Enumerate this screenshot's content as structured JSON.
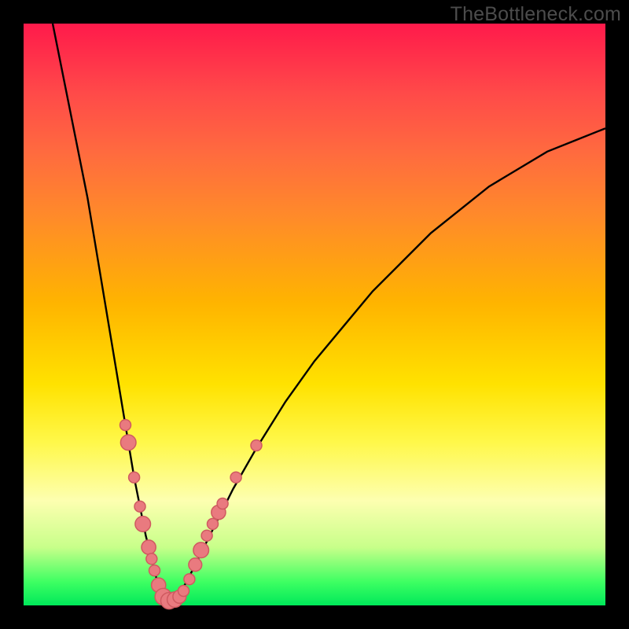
{
  "watermark": "TheBottleneck.com",
  "colors": {
    "frame_bg": "#000000",
    "gradient_stops": [
      {
        "pct": 0,
        "hex": "#ff1a4b"
      },
      {
        "pct": 12,
        "hex": "#ff4a49"
      },
      {
        "pct": 22,
        "hex": "#ff6a3f"
      },
      {
        "pct": 33,
        "hex": "#ff8a2a"
      },
      {
        "pct": 48,
        "hex": "#ffb400"
      },
      {
        "pct": 62,
        "hex": "#ffe200"
      },
      {
        "pct": 72,
        "hex": "#fff84a"
      },
      {
        "pct": 82,
        "hex": "#fdffb0"
      },
      {
        "pct": 90,
        "hex": "#c8ff8a"
      },
      {
        "pct": 96,
        "hex": "#3dff62"
      },
      {
        "pct": 100,
        "hex": "#00e85a"
      }
    ],
    "curve_stroke": "#000000",
    "dot_fill": "#e97a7f",
    "dot_stroke": "#cf5a60"
  },
  "chart_data": {
    "type": "line",
    "title": "",
    "xlabel": "",
    "ylabel": "",
    "xlim": [
      0,
      100
    ],
    "ylim": [
      0,
      100
    ],
    "grid": false,
    "curve": {
      "note": "Black V-shaped absolute-difference style curve; minimum at roughly x≈24, y≈0; left branch rises steeply to y=100 near x≈5; right branch rises gradually to y≈80 at x=100. Values estimated from pixels.",
      "points": [
        {
          "x": 5.0,
          "y": 100.0
        },
        {
          "x": 7.0,
          "y": 90.0
        },
        {
          "x": 9.0,
          "y": 80.0
        },
        {
          "x": 11.0,
          "y": 70.0
        },
        {
          "x": 13.0,
          "y": 58.0
        },
        {
          "x": 15.0,
          "y": 46.0
        },
        {
          "x": 17.0,
          "y": 34.0
        },
        {
          "x": 19.0,
          "y": 22.0
        },
        {
          "x": 21.0,
          "y": 12.0
        },
        {
          "x": 23.0,
          "y": 4.0
        },
        {
          "x": 24.0,
          "y": 1.0
        },
        {
          "x": 25.0,
          "y": 0.5
        },
        {
          "x": 26.0,
          "y": 1.0
        },
        {
          "x": 28.0,
          "y": 4.0
        },
        {
          "x": 30.0,
          "y": 8.0
        },
        {
          "x": 33.0,
          "y": 14.0
        },
        {
          "x": 36.0,
          "y": 20.0
        },
        {
          "x": 40.0,
          "y": 27.0
        },
        {
          "x": 45.0,
          "y": 35.0
        },
        {
          "x": 50.0,
          "y": 42.0
        },
        {
          "x": 55.0,
          "y": 48.0
        },
        {
          "x": 60.0,
          "y": 54.0
        },
        {
          "x": 65.0,
          "y": 59.0
        },
        {
          "x": 70.0,
          "y": 64.0
        },
        {
          "x": 75.0,
          "y": 68.0
        },
        {
          "x": 80.0,
          "y": 72.0
        },
        {
          "x": 85.0,
          "y": 75.0
        },
        {
          "x": 90.0,
          "y": 78.0
        },
        {
          "x": 95.0,
          "y": 80.0
        },
        {
          "x": 100.0,
          "y": 82.0
        }
      ]
    },
    "scatter": {
      "note": "Salmon/pink dots clustered around the bottom of the V; values estimated from pixel position on same 0–100 axes.",
      "points": [
        {
          "x": 17.5,
          "y": 31.0,
          "r": 1.0
        },
        {
          "x": 18.0,
          "y": 28.0,
          "r": 1.4
        },
        {
          "x": 19.0,
          "y": 22.0,
          "r": 1.0
        },
        {
          "x": 20.0,
          "y": 17.0,
          "r": 1.0
        },
        {
          "x": 20.5,
          "y": 14.0,
          "r": 1.4
        },
        {
          "x": 21.5,
          "y": 10.0,
          "r": 1.3
        },
        {
          "x": 22.0,
          "y": 8.0,
          "r": 1.0
        },
        {
          "x": 22.5,
          "y": 6.0,
          "r": 1.0
        },
        {
          "x": 23.2,
          "y": 3.5,
          "r": 1.3
        },
        {
          "x": 24.0,
          "y": 1.5,
          "r": 1.5
        },
        {
          "x": 25.0,
          "y": 0.8,
          "r": 1.5
        },
        {
          "x": 26.0,
          "y": 1.0,
          "r": 1.4
        },
        {
          "x": 26.8,
          "y": 1.5,
          "r": 1.2
        },
        {
          "x": 27.5,
          "y": 2.5,
          "r": 1.0
        },
        {
          "x": 28.5,
          "y": 4.5,
          "r": 1.0
        },
        {
          "x": 29.5,
          "y": 7.0,
          "r": 1.2
        },
        {
          "x": 30.5,
          "y": 9.5,
          "r": 1.4
        },
        {
          "x": 31.5,
          "y": 12.0,
          "r": 1.0
        },
        {
          "x": 32.5,
          "y": 14.0,
          "r": 1.0
        },
        {
          "x": 33.5,
          "y": 16.0,
          "r": 1.3
        },
        {
          "x": 34.2,
          "y": 17.5,
          "r": 1.0
        },
        {
          "x": 36.5,
          "y": 22.0,
          "r": 1.0
        },
        {
          "x": 40.0,
          "y": 27.5,
          "r": 1.0
        }
      ]
    }
  }
}
